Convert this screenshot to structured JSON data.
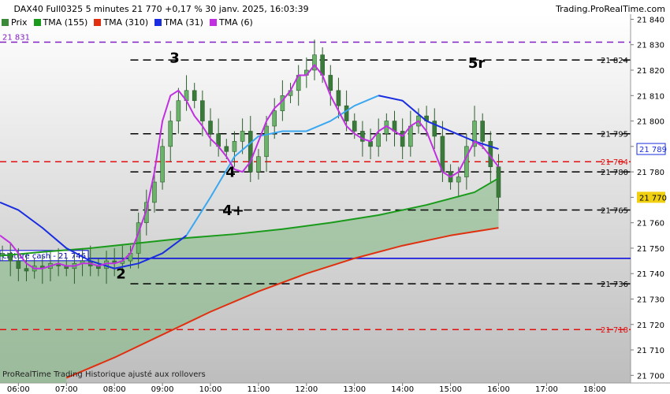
{
  "header": {
    "title": "DAX40 Full0325 5 minutes 21 770 +0,17 % 30 janv. 2025, 16:03:39",
    "brand": "Trading.ProRealTime.com"
  },
  "legend": [
    {
      "label": "Prix",
      "color": "#3a8a3a"
    },
    {
      "label": "TMA (155)",
      "color": "#1a9a1a"
    },
    {
      "label": "TMA (310)",
      "color": "#e03010"
    },
    {
      "label": "TMA (31)",
      "color": "#1a2ee0"
    },
    {
      "label": "TMA (6)",
      "color": "#c030e0"
    }
  ],
  "footer": {
    "text": "ProRealTime Trading Historique ajusté aux rollovers"
  },
  "colors": {
    "up": "#3a8a3a",
    "tma155": "#1a9a1a",
    "tma310": "#e03010",
    "tma31": "#1a2ee0",
    "tma6": "#c030e0",
    "tma31_light": "#3aa8f0",
    "red_dash": "#e01010",
    "purple_dash": "#8020c0",
    "blue_line": "#0000e0",
    "price_tag_bg": "#f0d010",
    "blue_tag_fg": "#1a2ee0"
  },
  "chart_data": {
    "type": "line",
    "title": "DAX40 Full0325 5 minutes",
    "ylim": [
      21697,
      21842
    ],
    "y_ticks": [
      21700,
      21710,
      21720,
      21730,
      21740,
      21750,
      21760,
      21770,
      21780,
      21790,
      21800,
      21810,
      21820,
      21830,
      21840
    ],
    "x_range": [
      "05:37",
      "18:45"
    ],
    "x_ticks": [
      "06:00",
      "07:00",
      "08:00",
      "09:00",
      "10:00",
      "11:00",
      "12:00",
      "13:00",
      "14:00",
      "15:00",
      "16:00",
      "17:00",
      "18:00"
    ],
    "horizontal_levels": [
      {
        "value": 21831,
        "label": "21 831",
        "style": "purple-dashed",
        "label_side": "left"
      },
      {
        "value": 21824,
        "label": "21 824",
        "style": "black-dashed",
        "from": "08:20"
      },
      {
        "value": 21795,
        "label": "21 795",
        "style": "black-dashed",
        "from": "08:20"
      },
      {
        "value": 21784,
        "label": "21 784",
        "style": "red-dashed"
      },
      {
        "value": 21780,
        "label": "21 780",
        "style": "black-dashed",
        "from": "08:20"
      },
      {
        "value": 21765,
        "label": "21 765",
        "style": "black-dashed",
        "from": "08:20"
      },
      {
        "value": 21746,
        "label": "clôture cash -  21 746",
        "style": "blue-solid"
      },
      {
        "value": 21736,
        "label": "21 736",
        "style": "black-dashed",
        "from": "08:20"
      },
      {
        "value": 21718,
        "label": "21 718",
        "style": "red-dashed"
      }
    ],
    "price_tags": [
      {
        "value": 21789,
        "label": "21 789",
        "kind": "tma31"
      },
      {
        "value": 21770,
        "label": "21 770",
        "kind": "price"
      }
    ],
    "wave_labels": [
      {
        "text": "2",
        "time": "08:02",
        "value": 21738
      },
      {
        "text": "3",
        "time": "09:09",
        "value": 21823
      },
      {
        "text": "4",
        "time": "10:19",
        "value": 21778
      },
      {
        "text": "4+",
        "time": "10:15",
        "value": 21763
      },
      {
        "text": "5r",
        "time": "15:22",
        "value": 21821
      }
    ],
    "series": [
      {
        "name": "Prix",
        "type": "ohlc",
        "x": [
          "05:40",
          "05:50",
          "06:00",
          "06:10",
          "06:20",
          "06:30",
          "06:40",
          "06:50",
          "07:00",
          "07:10",
          "07:20",
          "07:30",
          "07:40",
          "07:50",
          "08:00",
          "08:10",
          "08:20",
          "08:30",
          "08:40",
          "08:50",
          "09:00",
          "09:10",
          "09:20",
          "09:30",
          "09:40",
          "09:50",
          "10:00",
          "10:10",
          "10:20",
          "10:30",
          "10:40",
          "10:50",
          "11:00",
          "11:10",
          "11:20",
          "11:30",
          "11:40",
          "11:50",
          "12:00",
          "12:10",
          "12:20",
          "12:30",
          "12:40",
          "12:50",
          "13:00",
          "13:10",
          "13:20",
          "13:30",
          "13:40",
          "13:50",
          "14:00",
          "14:10",
          "14:20",
          "14:30",
          "14:40",
          "14:50",
          "15:00",
          "15:10",
          "15:20",
          "15:30",
          "15:40",
          "15:50",
          "16:00"
        ],
        "values": [
          21748,
          21745,
          21742,
          21741,
          21743,
          21742,
          21744,
          21743,
          21742,
          21744,
          21745,
          21743,
          21742,
          21745,
          21744,
          21745,
          21748,
          21760,
          21768,
          21776,
          21790,
          21800,
          21808,
          21812,
          21808,
          21800,
          21795,
          21790,
          21788,
          21792,
          21796,
          21780,
          21786,
          21798,
          21804,
          21810,
          21812,
          21818,
          21820,
          21826,
          21818,
          21812,
          21806,
          21800,
          21796,
          21792,
          21790,
          21795,
          21800,
          21796,
          21790,
          21798,
          21802,
          21800,
          21794,
          21780,
          21776,
          21778,
          21790,
          21800,
          21792,
          21782,
          21770
        ]
      },
      {
        "name": "TMA (155)",
        "x": [
          "05:37",
          "06:30",
          "07:30",
          "08:30",
          "09:30",
          "10:30",
          "11:30",
          "12:30",
          "13:30",
          "14:30",
          "15:30",
          "16:00"
        ],
        "values": [
          21747,
          21748.5,
          21750,
          21752,
          21754,
          21755.5,
          21757.5,
          21760,
          21763,
          21767,
          21772,
          21777.5
        ]
      },
      {
        "name": "TMA (310)",
        "x": [
          "07:00",
          "08:00",
          "09:00",
          "10:00",
          "11:00",
          "12:00",
          "13:00",
          "14:00",
          "15:00",
          "16:00"
        ],
        "values": [
          21699,
          21707,
          21716,
          21725,
          21733,
          21740,
          21746,
          21751,
          21755,
          21758
        ]
      },
      {
        "name": "TMA (31)",
        "x": [
          "05:37",
          "06:00",
          "06:30",
          "07:00",
          "07:30",
          "08:00",
          "08:30",
          "09:00",
          "09:30",
          "10:00",
          "10:30",
          "11:00",
          "11:30",
          "12:00",
          "12:30",
          "13:00",
          "13:30",
          "14:00",
          "14:30",
          "15:00",
          "15:30",
          "16:00"
        ],
        "values": [
          21768,
          21765,
          21758,
          21750,
          21745,
          21742,
          21744,
          21748,
          21755,
          21770,
          21786,
          21794,
          21796,
          21796,
          21800,
          21806,
          21810,
          21808,
          21800,
          21796,
          21792,
          21789
        ]
      },
      {
        "name": "TMA (6)",
        "x": [
          "05:37",
          "05:50",
          "06:00",
          "06:10",
          "06:20",
          "06:30",
          "06:40",
          "06:50",
          "07:00",
          "07:10",
          "07:20",
          "07:30",
          "07:40",
          "07:50",
          "08:00",
          "08:10",
          "08:20",
          "08:30",
          "08:40",
          "08:50",
          "09:00",
          "09:10",
          "09:20",
          "09:30",
          "09:40",
          "09:50",
          "10:00",
          "10:10",
          "10:20",
          "10:30",
          "10:40",
          "10:50",
          "11:00",
          "11:10",
          "11:20",
          "11:30",
          "11:40",
          "11:50",
          "12:00",
          "12:10",
          "12:20",
          "12:30",
          "12:40",
          "12:50",
          "13:00",
          "13:10",
          "13:20",
          "13:30",
          "13:40",
          "13:50",
          "14:00",
          "14:10",
          "14:20",
          "14:30",
          "14:40",
          "14:50",
          "15:00",
          "15:10",
          "15:20",
          "15:30",
          "15:40",
          "15:50",
          "16:00"
        ],
        "values": [
          21755,
          21752,
          21748,
          21744,
          21742,
          21742,
          21743,
          21744,
          21743,
          21743,
          21744,
          21744,
          21743,
          21744,
          21744,
          21745,
          21748,
          21756,
          21765,
          21780,
          21800,
          21810,
          21812,
          21808,
          21802,
          21798,
          21793,
          21790,
          21786,
          21781,
          21780,
          21784,
          21792,
          21800,
          21805,
          21808,
          21812,
          21818,
          21818,
          21822,
          21818,
          21810,
          21804,
          21798,
          21795,
          21793,
          21792,
          21796,
          21798,
          21796,
          21794,
          21798,
          21800,
          21796,
          21788,
          21780,
          21778,
          21780,
          21786,
          21792,
          21790,
          21786,
          21782
        ]
      }
    ]
  }
}
